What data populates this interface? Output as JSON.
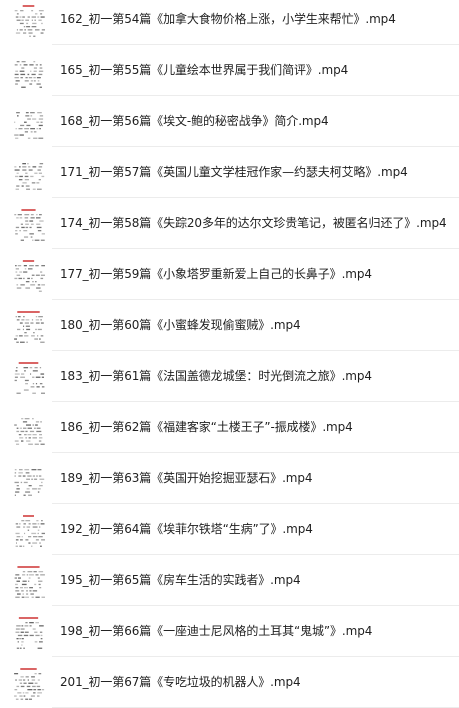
{
  "files": [
    {
      "name": "162_初一第54篇《加拿大食物价格上涨，小学生来帮忙》.mp4",
      "icon": "document-thumbnail-icon"
    },
    {
      "name": "165_初一第55篇《儿童绘本世界属于我们简评》.mp4",
      "icon": "document-thumbnail-icon"
    },
    {
      "name": "168_初一第56篇《埃文-鲍的秘密战争》简介.mp4",
      "icon": "document-thumbnail-icon"
    },
    {
      "name": "171_初一第57篇《英国儿童文学桂冠作家—约瑟夫柯艾略》.mp4",
      "icon": "document-thumbnail-icon"
    },
    {
      "name": "174_初一第58篇《失踪20多年的达尔文珍贵笔记，被匿名归还了》.mp4",
      "icon": "document-thumbnail-icon"
    },
    {
      "name": "177_初一第59篇《小象塔罗重新爱上自己的长鼻子》.mp4",
      "icon": "document-thumbnail-icon"
    },
    {
      "name": "180_初一第60篇《小蜜蜂发现偷蜜贼》.mp4",
      "icon": "document-thumbnail-icon"
    },
    {
      "name": "183_初一第61篇《法国盖德龙城堡：时光倒流之旅》.mp4",
      "icon": "document-thumbnail-icon"
    },
    {
      "name": "186_初一第62篇《福建客家“土楼王子”-振成楼》.mp4",
      "icon": "document-thumbnail-icon"
    },
    {
      "name": "189_初一第63篇《英国开始挖掘亚瑟石》.mp4",
      "icon": "document-thumbnail-icon"
    },
    {
      "name": "192_初一第64篇《埃菲尔铁塔“生病”了》.mp4",
      "icon": "document-thumbnail-icon"
    },
    {
      "name": "195_初一第65篇《房车生活的实践者》.mp4",
      "icon": "document-thumbnail-icon"
    },
    {
      "name": "198_初一第66篇《一座迪士尼风格的土耳其“鬼城”》.mp4",
      "icon": "document-thumbnail-icon"
    },
    {
      "name": "201_初一第67篇《专吃垃圾的机器人》.mp4",
      "icon": "document-thumbnail-icon"
    }
  ],
  "colors": {
    "text": "#1f1f1f",
    "divider": "#ececec",
    "thumb_ink": "#555555",
    "thumb_accent": "#d44a4a"
  }
}
